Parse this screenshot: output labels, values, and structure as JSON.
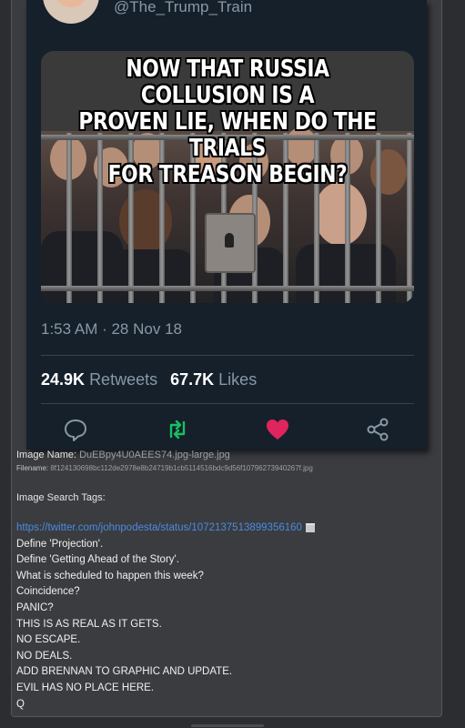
{
  "tweet": {
    "handle": "@The_Trump_Train",
    "meme_caption_lines": [
      "NOW THAT RUSSIA COLLUSION IS A",
      "PROVEN LIE, WHEN DO THE TRIALS",
      "FOR TREASON BEGIN?"
    ],
    "timestamp": "1:53 AM · 28 Nov 18",
    "retweets_count": "24.9K",
    "retweets_label": "Retweets",
    "likes_count": "67.7K",
    "likes_label": "Likes",
    "icons": {
      "reply": "reply-icon",
      "retweet": "retweet-icon",
      "like": "heart-icon",
      "share": "share-icon"
    },
    "colors": {
      "background": "#15202b",
      "muted_text": "#8899a6",
      "retweet": "#17bf63",
      "like": "#e0245e"
    }
  },
  "image_info": {
    "name_label": "Image Name:",
    "name_value": "DuEBpy4U0AEES74.jpg-large.jpg",
    "filename_label": "Filename:",
    "filename_value": "8f124130698bc112de2978e8b24719b1cb5114516bdc9d56f10796273940267f.jpg",
    "tags_label": "Image Search Tags:"
  },
  "post": {
    "link": "https://twitter.com/johnpodesta/status/1072137513899356160",
    "lines": [
      "Define 'Projection'.",
      "Define 'Getting Ahead of the Story'.",
      "What is scheduled to happen this week?",
      "Coincidence?",
      "PANIC?",
      "THIS IS AS REAL AS IT GETS.",
      "NO ESCAPE.",
      "NO DEALS.",
      "ADD BRENNAN TO GRAPHIC AND UPDATE.",
      "EVIL HAS NO PLACE HERE.",
      "Q"
    ],
    "link_color": "#4d8ae0"
  }
}
